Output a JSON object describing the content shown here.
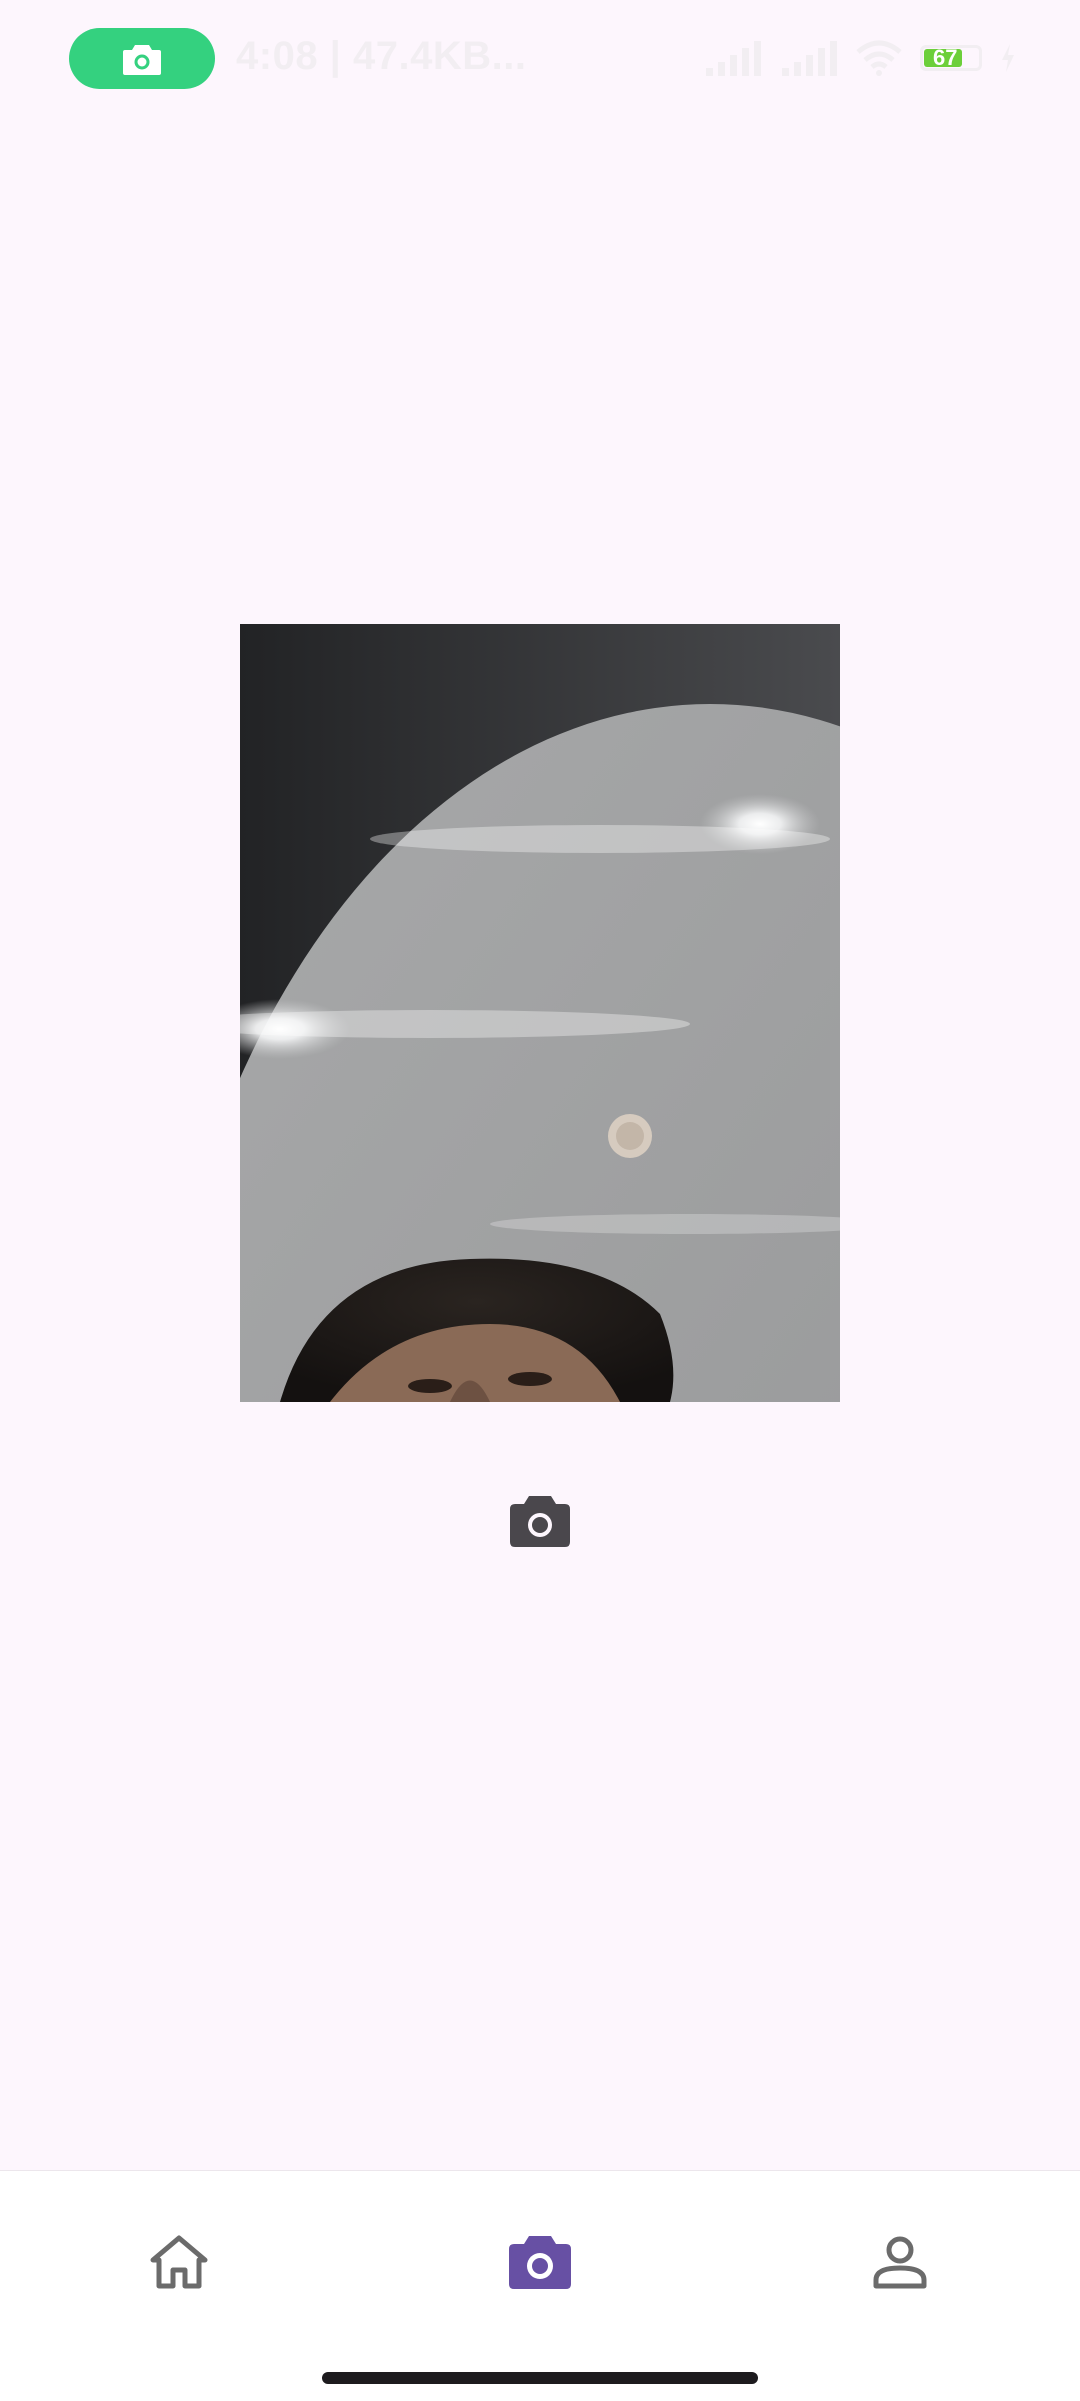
{
  "status_bar": {
    "recording_icon": "camera-icon",
    "info_text": "4:08 | 47.4KB...",
    "signal_icons": [
      "signal-icon",
      "signal-icon"
    ],
    "wifi_icon": "wifi-icon",
    "battery_level": "67",
    "battery_color": "#6ccf3a",
    "recording_color": "#34d17f"
  },
  "preview": {
    "capture_icon": "camera-icon"
  },
  "bottom_nav": {
    "items": [
      {
        "icon": "home-icon",
        "active": false
      },
      {
        "icon": "camera-icon",
        "active": true
      },
      {
        "icon": "person-icon",
        "active": false
      }
    ],
    "active_color": "#6750a4",
    "inactive_color": "#6b6b6b"
  }
}
